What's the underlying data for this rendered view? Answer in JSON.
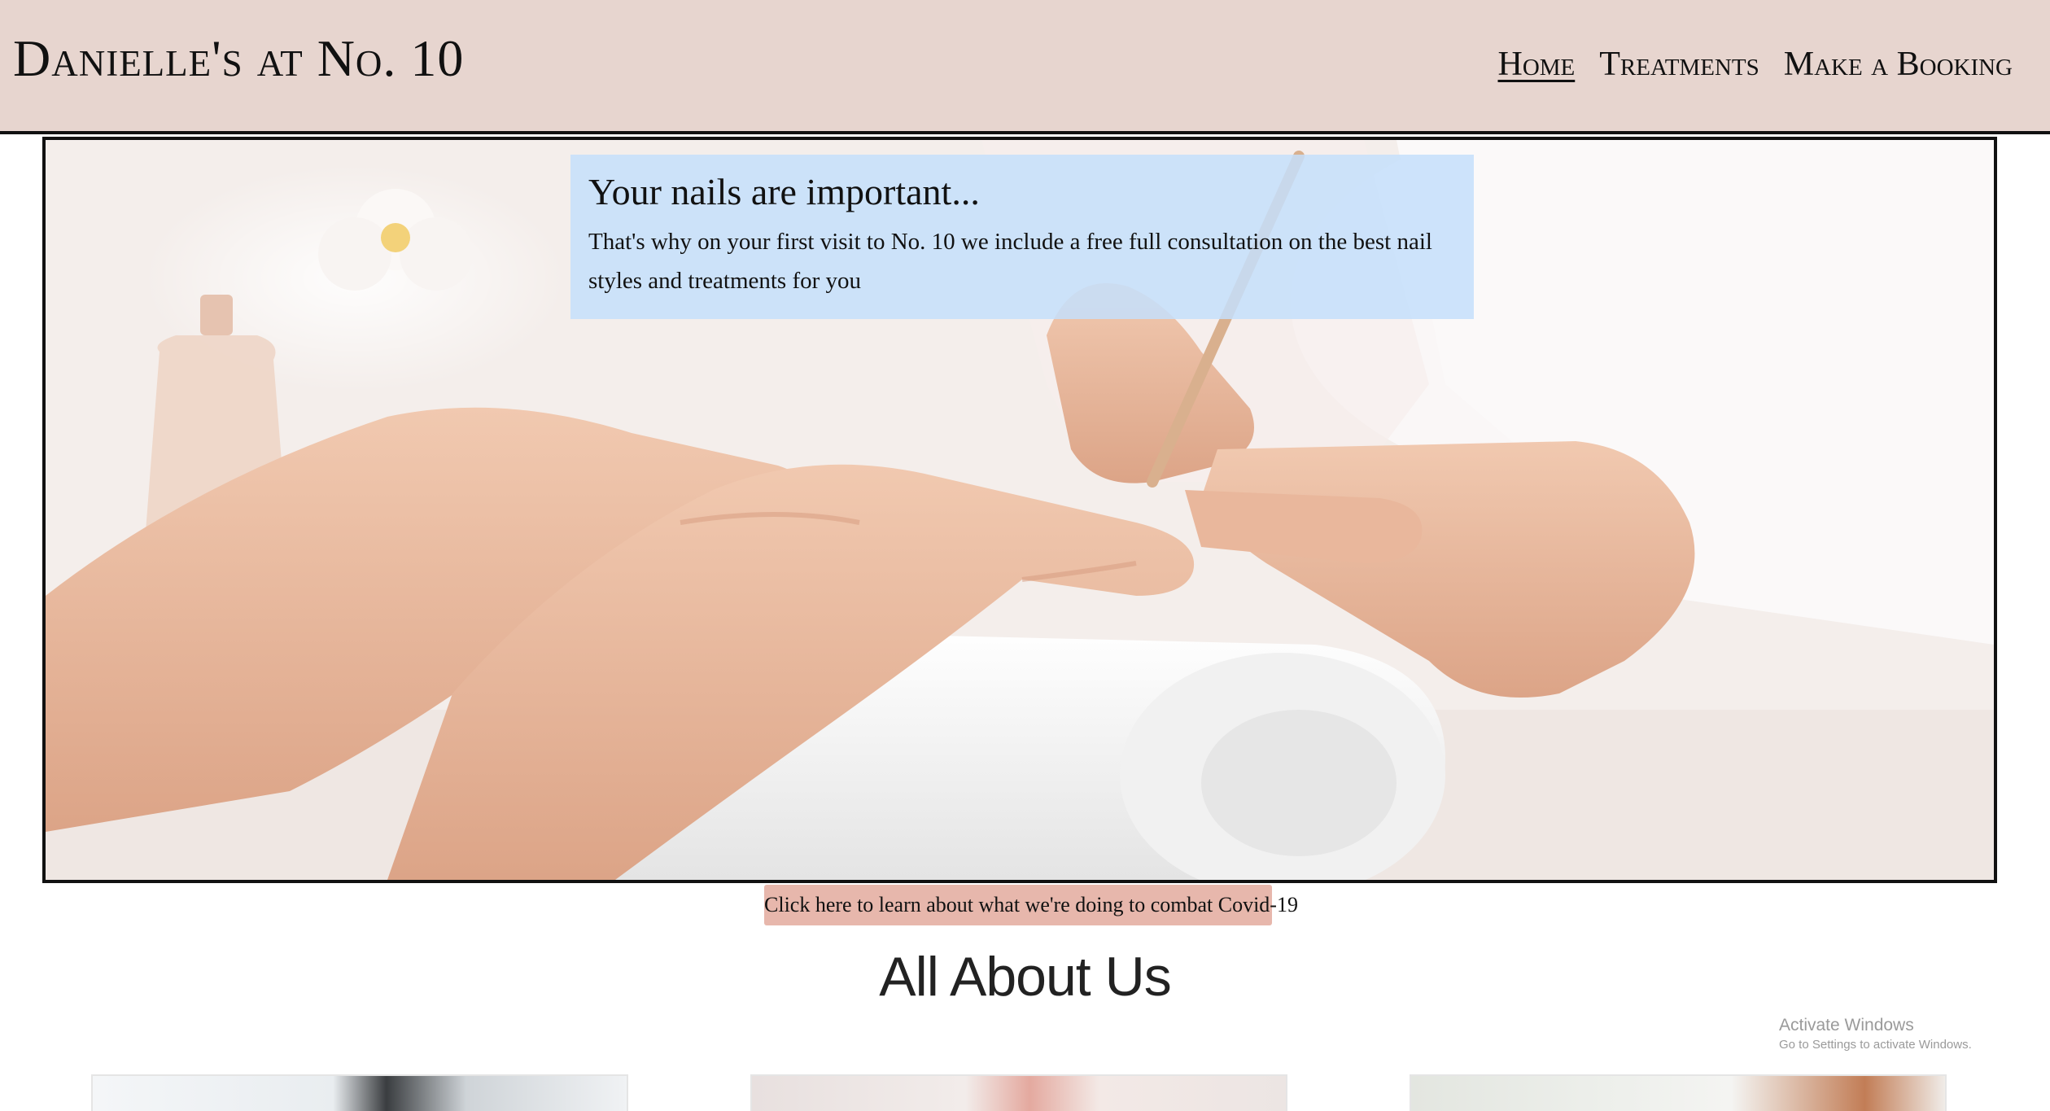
{
  "header": {
    "brand": "Danielle's at No. 10",
    "nav": [
      {
        "label": "Home",
        "active": true
      },
      {
        "label": "Treatments",
        "active": false
      },
      {
        "label": "Make a Booking",
        "active": false
      }
    ],
    "background_color": "#e7d5cf"
  },
  "hero": {
    "image_subject": "manicure-photo",
    "caption_title": "Your nails are important...",
    "caption_text": "That's why on your first visit to No. 10 we include a free full consultation on the best nail styles and treatments for you",
    "caption_bg_color": "#c4dffc"
  },
  "covid_button": {
    "label": "Click here to learn about what we're doing to combat Covid-19",
    "color": "#e7b7ac"
  },
  "about": {
    "heading": "All About Us",
    "cards": [
      {
        "image_subject": "salon-photo-1"
      },
      {
        "image_subject": "salon-photo-2"
      },
      {
        "image_subject": "salon-photo-3"
      }
    ]
  },
  "system_watermark": {
    "line1": "Activate Windows",
    "line2": "Go to Settings to activate Windows."
  }
}
